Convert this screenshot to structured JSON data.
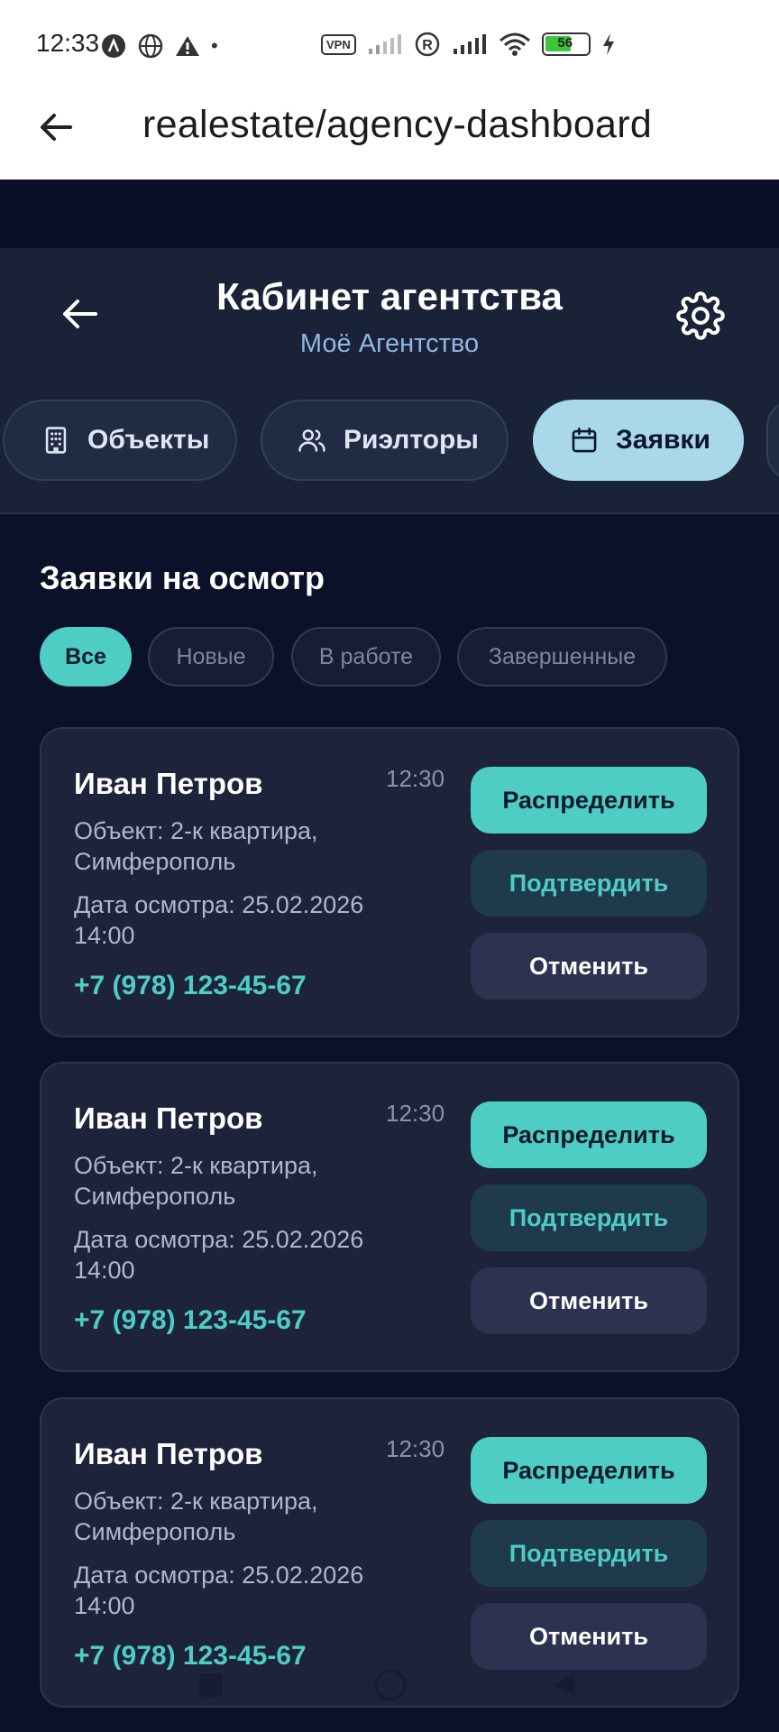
{
  "status_bar": {
    "time": "12:33",
    "vpn": "VPN",
    "battery": "56"
  },
  "browser": {
    "url_title": "realestate/agency-dashboard"
  },
  "header": {
    "title": "Кабинет агентства",
    "subtitle": "Моё Агентство"
  },
  "tabs": [
    {
      "label": "Объекты",
      "icon": "building-icon",
      "active": false
    },
    {
      "label": "Риэлторы",
      "icon": "users-icon",
      "active": false
    },
    {
      "label": "Заявки",
      "icon": "calendar-icon",
      "active": true
    }
  ],
  "section": {
    "title": "Заявки на осмотр"
  },
  "filters": [
    {
      "label": "Все",
      "active": true
    },
    {
      "label": "Новые",
      "active": false
    },
    {
      "label": "В работе",
      "active": false
    },
    {
      "label": "Завершенные",
      "active": false
    }
  ],
  "requests": [
    {
      "name": "Иван Петров",
      "time": "12:30",
      "object": "Объект: 2-к квартира, Симферополь",
      "date": "Дата осмотра: 25.02.2026 14:00",
      "phone": "+7 (978) 123-45-67",
      "actions": {
        "distribute": "Распределить",
        "confirm": "Подтвердить",
        "cancel": "Отменить"
      }
    },
    {
      "name": "Иван Петров",
      "time": "12:30",
      "object": "Объект: 2-к квартира, Симферополь",
      "date": "Дата осмотра: 25.02.2026 14:00",
      "phone": "+7 (978) 123-45-67",
      "actions": {
        "distribute": "Распределить",
        "confirm": "Подтвердить",
        "cancel": "Отменить"
      }
    },
    {
      "name": "Иван Петров",
      "time": "12:30",
      "object": "Объект: 2-к квартира, Симферополь",
      "date": "Дата осмотра: 25.02.2026 14:00",
      "phone": "+7 (978) 123-45-67",
      "actions": {
        "distribute": "Распределить",
        "confirm": "Подтвердить",
        "cancel": "Отменить"
      }
    }
  ],
  "colors": {
    "accent": "#4ecdc4",
    "active_tab": "#a8d8ea",
    "background": "#0c112a",
    "card": "#1c233b"
  }
}
